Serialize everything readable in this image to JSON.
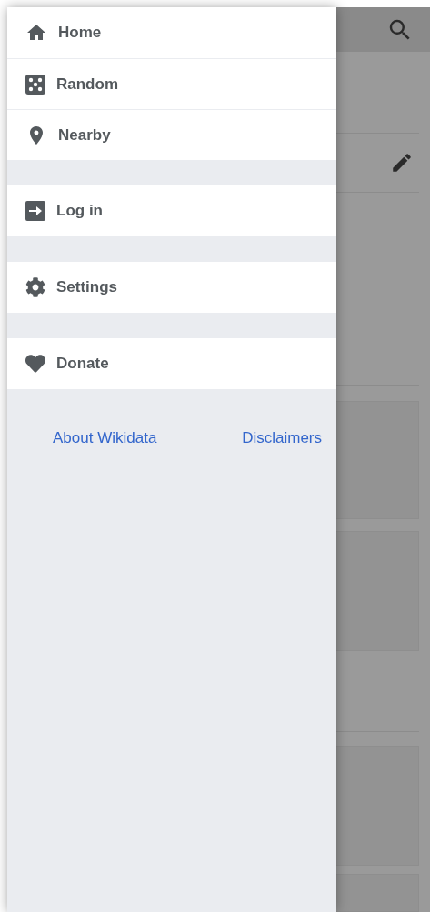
{
  "menu": {
    "groups": [
      {
        "items": [
          {
            "kind": "home",
            "label": "Home"
          },
          {
            "kind": "random",
            "label": "Random"
          },
          {
            "kind": "nearby",
            "label": "Nearby"
          }
        ]
      },
      {
        "items": [
          {
            "kind": "login",
            "label": "Log in"
          }
        ]
      },
      {
        "items": [
          {
            "kind": "settings",
            "label": "Settings"
          }
        ]
      },
      {
        "items": [
          {
            "kind": "donate",
            "label": "Donate"
          }
        ]
      }
    ]
  },
  "footer_links": [
    "About Wikidata",
    "Disclaimers"
  ]
}
